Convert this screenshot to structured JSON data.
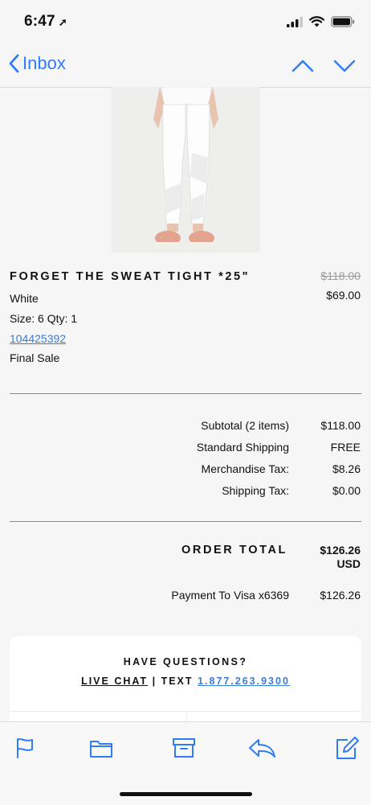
{
  "status_bar": {
    "time": "6:47",
    "location_arrow": "➚"
  },
  "nav": {
    "back_label": "Inbox"
  },
  "product": {
    "name": "FORGET THE SWEAT TIGHT *25\"",
    "original_price": "$118.00",
    "sale_price": "$69.00",
    "color": "White",
    "size_qty": "Size: 6 Qty: 1",
    "sku": "104425392",
    "note": "Final Sale"
  },
  "summary": {
    "rows": [
      {
        "label": "Subtotal (2 items)",
        "value": "$118.00"
      },
      {
        "label": "Standard Shipping",
        "value": "FREE"
      },
      {
        "label": "Merchandise Tax:",
        "value": "$8.26"
      },
      {
        "label": "Shipping Tax:",
        "value": "$0.00"
      }
    ],
    "order_total_label": "ORDER TOTAL",
    "order_total_amount": "$126.26",
    "order_total_currency": "USD",
    "payment_label": "Payment To Visa x6369",
    "payment_value": "$126.26"
  },
  "help_card": {
    "title": "HAVE QUESTIONS?",
    "live_chat": "LIVE CHAT",
    "separator": "| TEXT",
    "phone": "1.877.263.9300"
  },
  "colors": {
    "accent": "#2f7cf6",
    "link": "#3a7bd5"
  },
  "toolbar_icons": [
    "flag-icon",
    "folder-icon",
    "archive-icon",
    "reply-icon",
    "compose-icon"
  ]
}
